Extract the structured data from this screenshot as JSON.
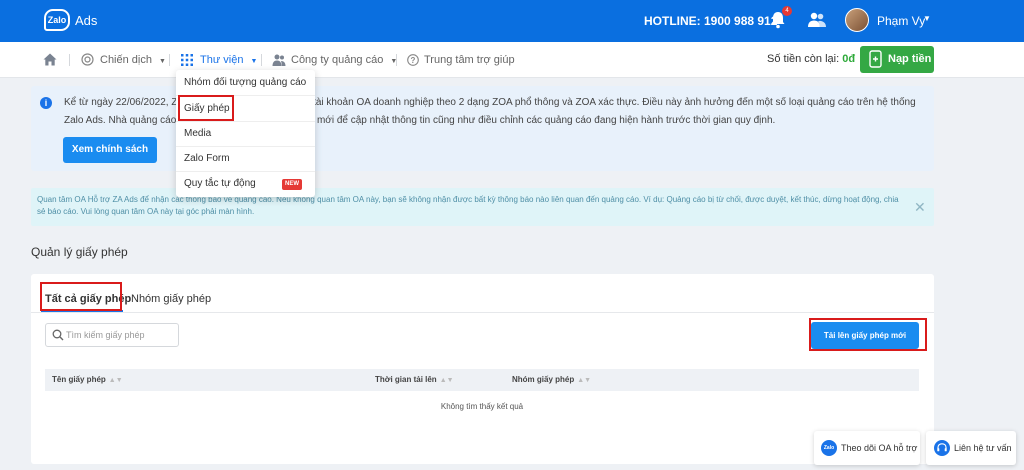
{
  "header": {
    "logo_text": "Zalo",
    "product": "Ads",
    "hotline": "HOTLINE: 1900 988 912",
    "notifications_count": "4",
    "username": "Phạm Vy"
  },
  "nav": {
    "items": [
      {
        "label": "Chiến dịch"
      },
      {
        "label": "Thư viện"
      },
      {
        "label": "Công ty quảng cáo"
      },
      {
        "label": "Trung tâm trợ giúp"
      }
    ],
    "balance_label": "Số tiền còn lại: ",
    "balance_value": "0đ",
    "topup_label": "Nạp tiền"
  },
  "dropdown": {
    "items": [
      {
        "label": "Nhóm đối tượng quảng cáo"
      },
      {
        "label": "Giấy phép"
      },
      {
        "label": "Media"
      },
      {
        "label": "Zalo Form"
      },
      {
        "label": "Quy tắc tự động",
        "badge": "NEW"
      }
    ]
  },
  "notice": {
    "text": "Kể từ ngày 22/06/2022, Zalo Ads sẽ triển khai phân loại tài khoản OA doanh nghiệp theo 2 dạng ZOA phổ thông và ZOA xác thực. Điều này ảnh hưởng đến một số loại quảng cáo trên hệ thống Zalo Ads. Nhà quảng cáo vui lòng tham khảo chính sách mới để cập nhật thông tin cũng như điều chỉnh các quảng cáo đang hiện hành trước thời gian quy định.",
    "button": "Xem chính sách"
  },
  "info": {
    "text": "Quan tâm OA Hỗ trợ ZA Ads để nhận các thông báo về quảng cáo. Nếu không quan tâm OA này, bạn sẽ không nhận được bất kỳ thông báo nào liên quan đến quảng cáo. Ví dụ: Quảng cáo bị từ chối, được duyệt, kết thúc, dừng hoạt động, chia sẻ báo cáo. Vui lòng quan tâm OA này tại góc phải màn hình.",
    "close": "✕"
  },
  "section": {
    "title": "Quản lý giấy phép"
  },
  "tabs": [
    {
      "label": "Tất cả giấy phép"
    },
    {
      "label": "Nhóm giấy phép"
    }
  ],
  "search": {
    "placeholder": "Tìm kiếm giấy phép",
    "value": ""
  },
  "upload_button": "Tải lên giấy phép mới",
  "table": {
    "columns": [
      "Tên giấy phép",
      "Thời gian tải lên",
      "Nhóm giấy phép"
    ],
    "empty_text": "Không tìm thấy kết quả"
  },
  "floating": {
    "oa_icon_text": "Zalo",
    "follow_oa": "Theo dõi OA hỗ trợ",
    "consult": "Liên hệ tư vấn"
  },
  "colors": {
    "primary": "#0a6fe0",
    "button": "#1a8cf0",
    "topup": "#34a844",
    "highlight": "#d91b1b"
  }
}
